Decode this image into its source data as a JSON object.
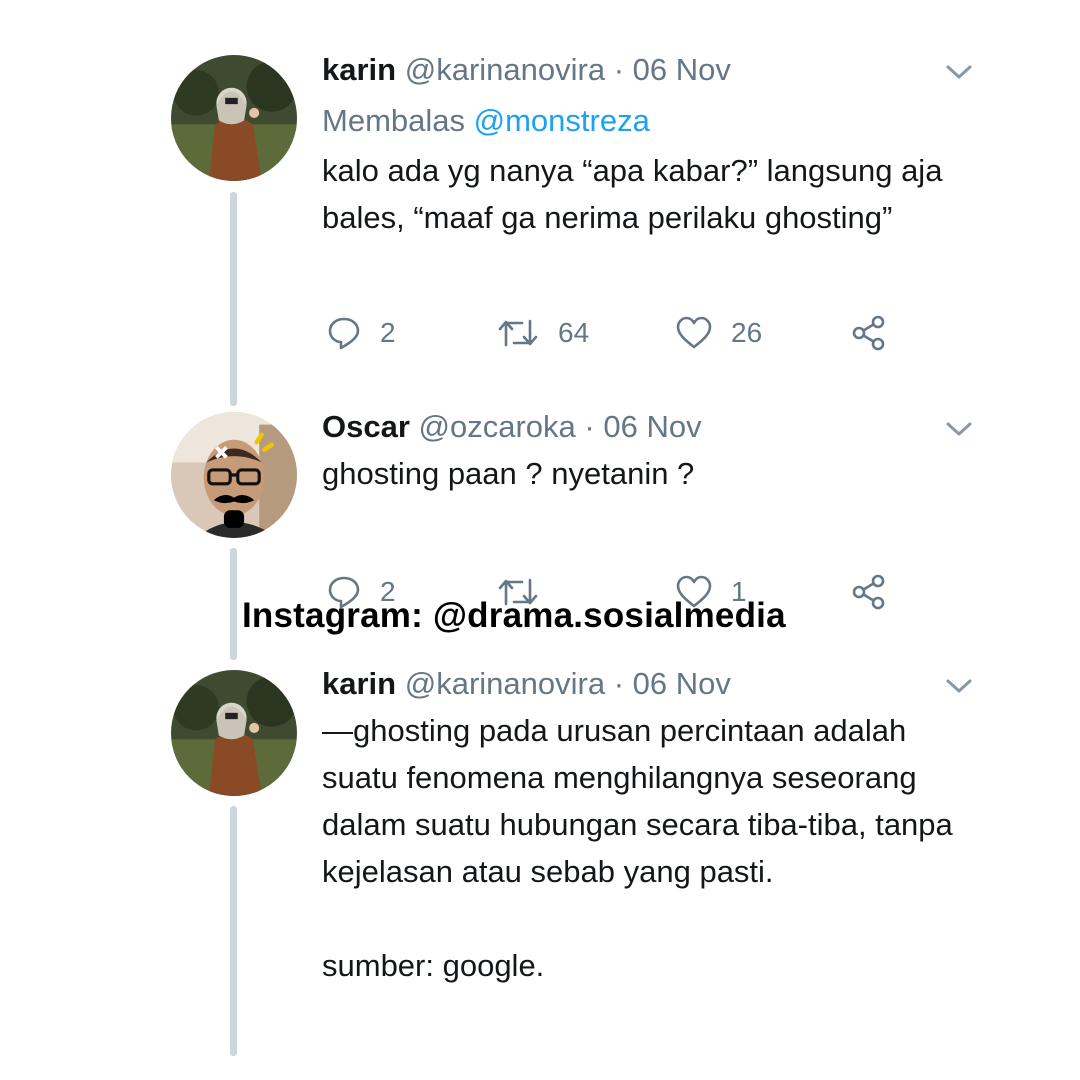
{
  "colors": {
    "text": "#14171a",
    "secondary": "#657786",
    "link": "#1da1f2",
    "thread_line": "#ccd6dd"
  },
  "tweets": [
    {
      "name": "karin",
      "handle": "@karinanovira",
      "date": "· 06 Nov",
      "reply_prefix": "Membalas",
      "reply_to": "@monstreza",
      "text": "kalo ada yg nanya “apa kabar?” langsung aja bales, “maaf ga nerima perilaku ghosting”",
      "replies": "2",
      "retweets": "64",
      "likes": "26"
    },
    {
      "name": "Oscar",
      "handle": "@ozcaroka",
      "date": "· 06 Nov",
      "text": "ghosting paan ? nyetanin ?",
      "replies": "2",
      "retweets": "",
      "likes": "1"
    },
    {
      "name": "karin",
      "handle": "@karinanovira",
      "date": "· 06 Nov",
      "text": "—ghosting pada urusan percintaan adalah suatu fenomena menghilangnya seseorang dalam suatu hubungan secara tiba-tiba, tanpa kejelasan atau sebab yang pasti.\n\nsumber: google."
    }
  ],
  "watermark": "Instagram: @drama.sosialmedia"
}
